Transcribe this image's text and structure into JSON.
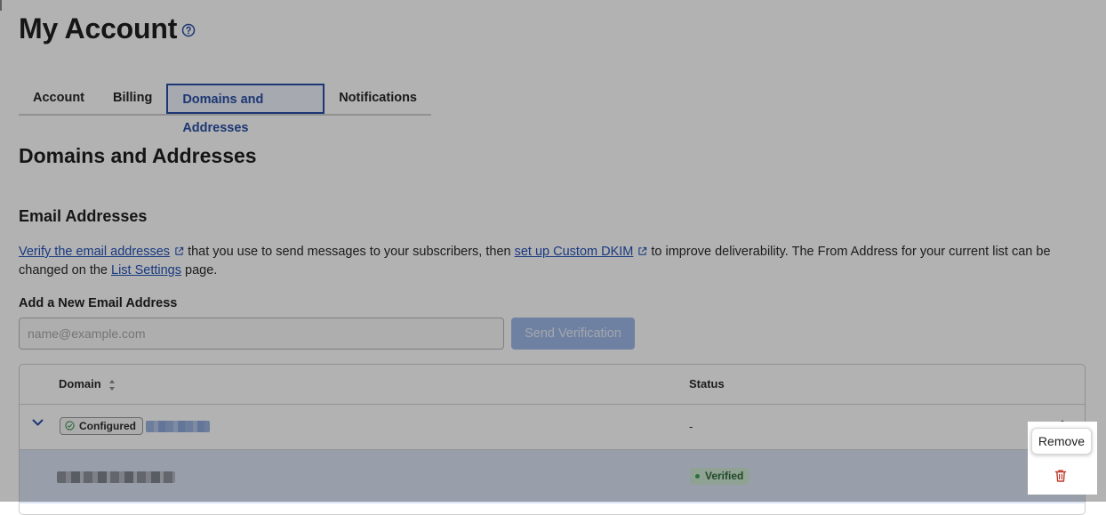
{
  "page": {
    "title": "My Account"
  },
  "tabs": [
    {
      "label": "Account",
      "active": false
    },
    {
      "label": "Billing",
      "active": false
    },
    {
      "label": "Domains and Addresses",
      "active": true
    },
    {
      "label": "Notifications",
      "active": false
    }
  ],
  "section": {
    "title": "Domains and Addresses"
  },
  "email_section": {
    "title": "Email Addresses",
    "desc": {
      "link1": "Verify the email addresses",
      "text1": "that you use to send messages to your subscribers, then",
      "link2": "set up Custom DKIM",
      "text2": "to improve deliverability. The From Address for your current list can be changed on the",
      "link3": "List Settings",
      "text3": "page."
    },
    "add_label": "Add a New Email Address",
    "input_placeholder": "name@example.com",
    "input_value": "",
    "send_button": "Send Verification"
  },
  "table": {
    "columns": {
      "domain": "Domain",
      "status": "Status"
    },
    "rows": [
      {
        "badge": "Configured",
        "status": "-"
      },
      {
        "status_badge": "Verified"
      }
    ]
  },
  "menu": {
    "remove": "Remove"
  },
  "icons": {
    "help": "help-circle-icon",
    "external": "external-link-icon",
    "sort": "sort-icon",
    "chevron": "chevron-down-icon",
    "check": "check-circle-icon",
    "kebab": "kebab-menu-icon",
    "trash": "trash-icon"
  },
  "colors": {
    "accent": "#2a4fa6",
    "link": "#2452b8",
    "verified_bg": "#cfe8d3",
    "danger": "#c0392b",
    "button_disabled": "#9fb9e8"
  }
}
